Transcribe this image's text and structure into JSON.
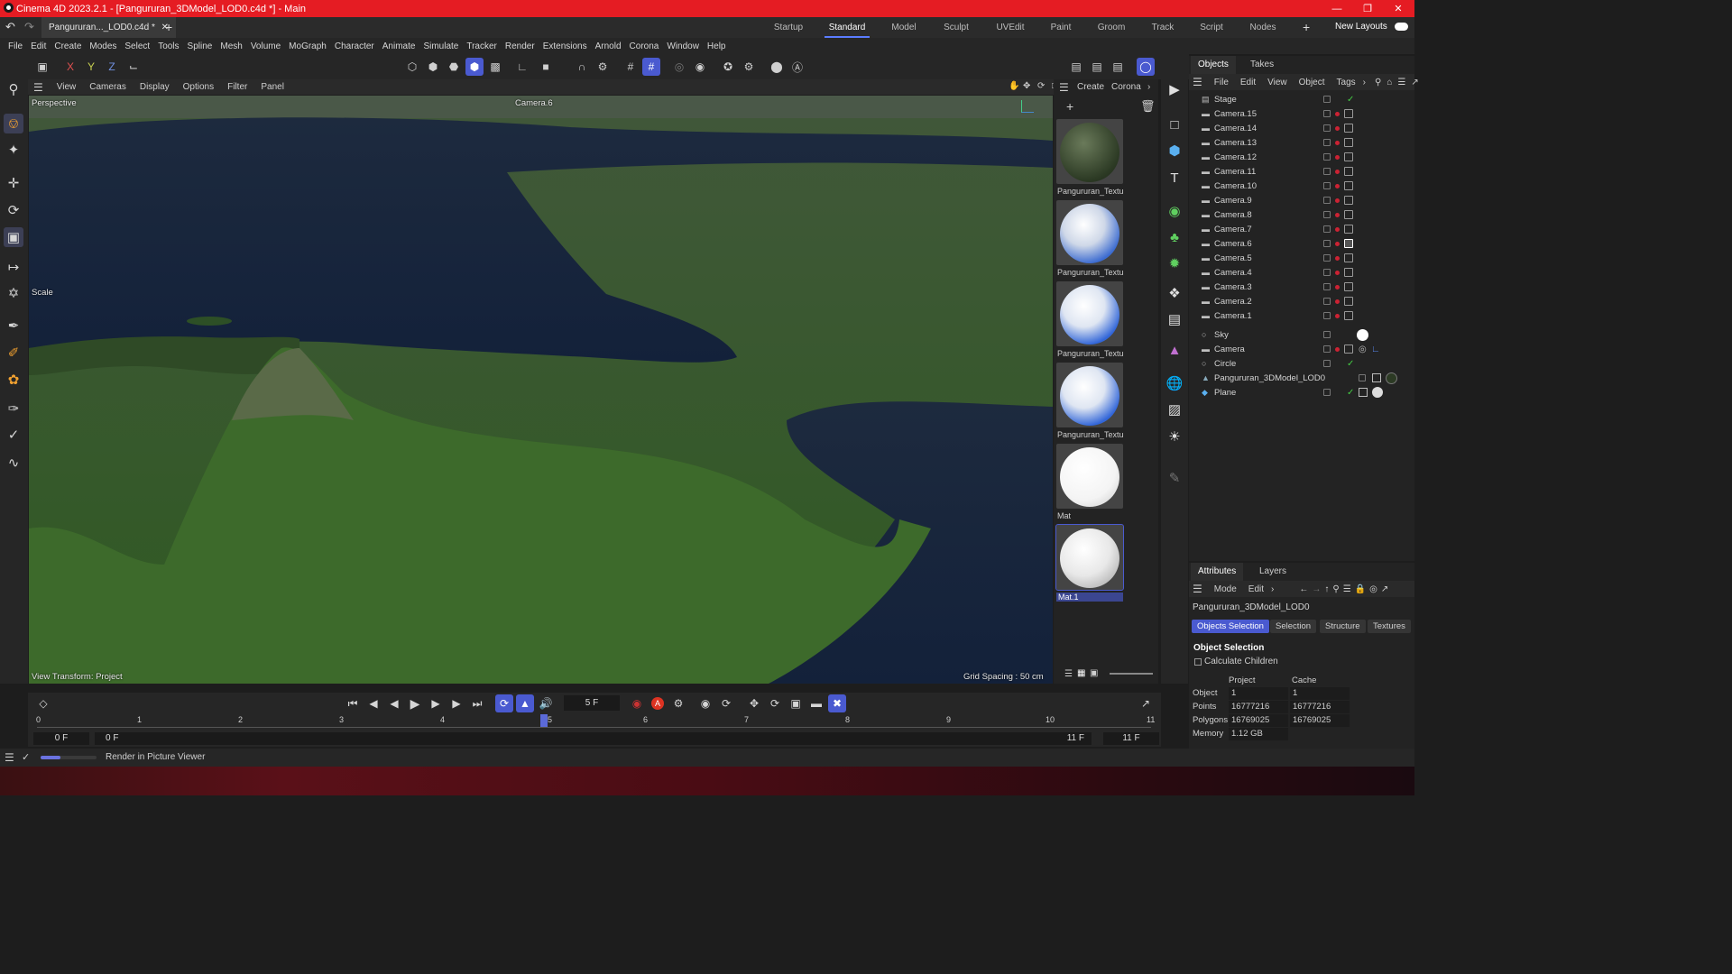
{
  "window": {
    "title": "Cinema 4D 2023.2.1 - [Pangururan_3DModel_LOD0.c4d *] - Main",
    "controls": [
      "minimize-icon",
      "restore-icon",
      "close-icon"
    ]
  },
  "tabs": {
    "document": "Pangururan..._LOD0.c4d *",
    "layouts": [
      "Startup",
      "Standard",
      "Model",
      "Sculpt",
      "UVEdit",
      "Paint",
      "Groom",
      "Track",
      "Script",
      "Nodes"
    ],
    "active_layout": "Standard",
    "new_layouts": "New Layouts"
  },
  "menu": [
    "File",
    "Edit",
    "Create",
    "Modes",
    "Select",
    "Tools",
    "Spline",
    "Mesh",
    "Volume",
    "MoGraph",
    "Character",
    "Animate",
    "Simulate",
    "Tracker",
    "Render",
    "Extensions",
    "Arnold",
    "Corona",
    "Window",
    "Help"
  ],
  "toolbar": {
    "x": "X",
    "y": "Y",
    "z": "Z"
  },
  "viewport": {
    "menu": [
      "View",
      "Cameras",
      "Display",
      "Options",
      "Filter",
      "Panel"
    ],
    "projection": "Perspective",
    "camera": "Camera.6",
    "tool": "Scale",
    "view_transform": "View Transform: Project",
    "grid_spacing": "Grid Spacing : 50 cm"
  },
  "materials": {
    "menu": [
      "Create",
      "Corona"
    ],
    "items": [
      {
        "name": "Pangururan_Textu",
        "kind": "terrain"
      },
      {
        "name": "Pangururan_Textu",
        "kind": "blue-white"
      },
      {
        "name": "Pangururan_Textu",
        "kind": "blue-white"
      },
      {
        "name": "Pangururan_Textu",
        "kind": "blue-white"
      },
      {
        "name": "Mat",
        "kind": "white"
      },
      {
        "name": "Mat.1",
        "kind": "white-selected"
      }
    ]
  },
  "objects": {
    "tabs": [
      "Objects",
      "Takes"
    ],
    "menu": [
      "File",
      "Edit",
      "View",
      "Object",
      "Tags"
    ],
    "rows": [
      "Stage",
      "Camera.15",
      "Camera.14",
      "Camera.13",
      "Camera.12",
      "Camera.11",
      "Camera.10",
      "Camera.9",
      "Camera.8",
      "Camera.7",
      "Camera.6",
      "Camera.5",
      "Camera.4",
      "Camera.3",
      "Camera.2",
      "Camera.1",
      "Sky",
      "Camera",
      "Circle",
      "Pangururan_3DModel_LOD0",
      "Plane"
    ]
  },
  "attributes": {
    "tabs": [
      "Attributes",
      "Layers"
    ],
    "menu": [
      "Mode",
      "Edit"
    ],
    "object_name": "Pangururan_3DModel_LOD0",
    "buttons": [
      "Objects Selection",
      "Selection",
      "Structure",
      "Textures"
    ],
    "section": "Object Selection",
    "calc_children": "Calculate Children",
    "col_project": "Project",
    "col_cache": "Cache",
    "rows": [
      {
        "label": "Object",
        "project": "1",
        "cache": "1"
      },
      {
        "label": "Points",
        "project": "16777216",
        "cache": "16777216"
      },
      {
        "label": "Polygons",
        "project": "16769025",
        "cache": "16769025"
      },
      {
        "label": "Memory",
        "project": "1.12 GB",
        "cache": ""
      }
    ]
  },
  "timeline": {
    "current_frame": "5 F",
    "ticks": [
      "0",
      "1",
      "2",
      "3",
      "4",
      "5",
      "6",
      "7",
      "8",
      "9",
      "10",
      "11"
    ],
    "start": "0 F",
    "start2": "0 F",
    "end": "11 F",
    "end2": "11 F"
  },
  "status": {
    "text": "Render in Picture Viewer",
    "progress": 0.35
  }
}
